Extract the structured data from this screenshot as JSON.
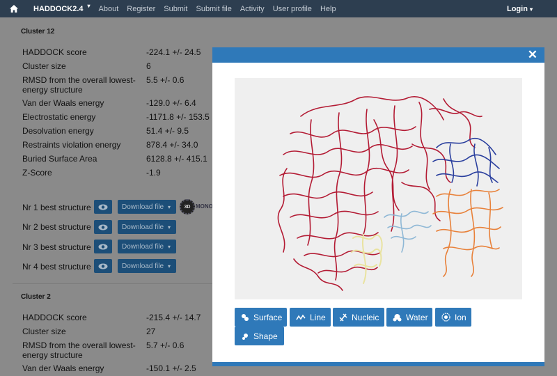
{
  "navbar": {
    "brand": "HADDOCK2.4",
    "links": [
      "About",
      "Register",
      "Submit",
      "Submit file",
      "Activity",
      "User profile",
      "Help"
    ],
    "login": "Login"
  },
  "clusters": [
    {
      "title": "Cluster 12",
      "stats": [
        {
          "label": "HADDOCK score",
          "value": "-224.1 +/- 24.5"
        },
        {
          "label": "Cluster size",
          "value": "6"
        },
        {
          "label": "RMSD from the overall lowest-",
          "label2": "energy structure",
          "value": "5.5 +/- 0.6"
        },
        {
          "label": "Van der Waals energy",
          "value": "-129.0 +/- 6.4"
        },
        {
          "label": "Electrostatic energy",
          "value": "-1171.8 +/- 153.5"
        },
        {
          "label": "Desolvation energy",
          "value": "51.4 +/- 9.5"
        },
        {
          "label": "Restraints violation energy",
          "value": "878.4 +/- 34.0"
        },
        {
          "label": "Buried Surface Area",
          "value": "6128.8 +/- 415.1"
        },
        {
          "label": "Z-Score",
          "value": "-1.9"
        }
      ],
      "best": [
        "Nr 1 best structure",
        "Nr 2 best structure",
        "Nr 3 best structure",
        "Nr 4 best structure"
      ],
      "download_label": "Download file",
      "logo_text": "3D",
      "logo_caption": "MONO"
    },
    {
      "title": "Cluster 2",
      "stats": [
        {
          "label": "HADDOCK score",
          "value": "-215.4 +/- 14.7"
        },
        {
          "label": "Cluster size",
          "value": "27"
        },
        {
          "label": "RMSD from the overall lowest-",
          "label2": "energy structure",
          "value": "5.7 +/- 0.6"
        },
        {
          "label": "Van der Waals energy",
          "value": "-150.1 +/- 2.5"
        }
      ]
    }
  ],
  "modal": {
    "close": "✕",
    "buttons": [
      "Surface",
      "Line",
      "Nucleic",
      "Water",
      "Ion",
      "Shape"
    ]
  },
  "colors": {
    "navbar": "#2d3e50",
    "modal_accent": "#2f79b9",
    "chain_red": "#b0102a",
    "chain_blue": "#2a3f9e",
    "chain_orange": "#e8813a",
    "chain_lightblue": "#8fb8d6",
    "chain_yellow": "#e9e3a0"
  }
}
